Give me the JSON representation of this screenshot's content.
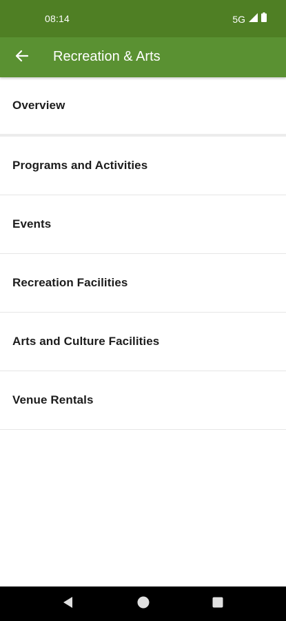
{
  "status_bar": {
    "time": "08:14",
    "network": "5G",
    "signal_icon": "signal-icon",
    "battery_icon": "battery-icon"
  },
  "app_bar": {
    "back_icon": "arrow-back-icon",
    "title": "Recreation & Arts",
    "color": "#5a9132"
  },
  "menu": {
    "items": [
      {
        "label": "Overview"
      },
      {
        "label": "Programs and Activities"
      },
      {
        "label": "Events"
      },
      {
        "label": "Recreation Facilities"
      },
      {
        "label": "Arts and Culture Facilities"
      },
      {
        "label": "Venue Rentals"
      }
    ]
  },
  "nav_bar": {
    "back_icon": "nav-back-icon",
    "home_icon": "nav-home-icon",
    "recents_icon": "nav-recents-icon"
  }
}
